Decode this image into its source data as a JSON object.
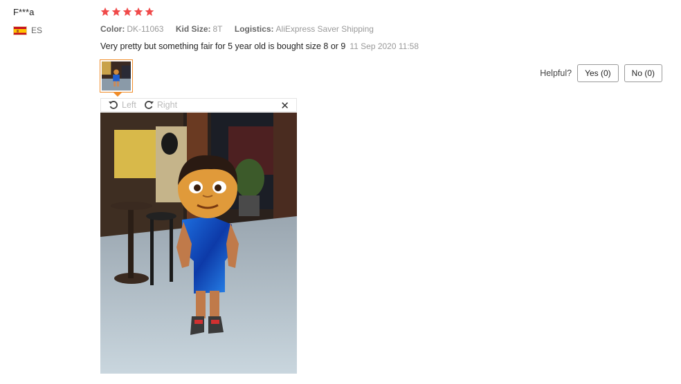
{
  "user": {
    "name": "F***a",
    "country": "ES"
  },
  "rating": 5,
  "attributes": [
    {
      "label": "Color:",
      "value": "DK-11063"
    },
    {
      "label": "Kid Size:",
      "value": "8T"
    },
    {
      "label": "Logistics:",
      "value": "AliExpress Saver Shipping"
    }
  ],
  "review": {
    "text": "Very pretty but something fair for 5 year old is bought size 8 or 9",
    "date": "11 Sep 2020 11:58"
  },
  "helpful": {
    "label": "Helpful?",
    "yes": "Yes (0)",
    "no": "No (0)"
  },
  "viewer": {
    "rotate_left": "Left",
    "rotate_right": "Right",
    "close_icon": "close-icon"
  },
  "colors": {
    "star": "#f04a4a",
    "accent": "#f08c29"
  }
}
